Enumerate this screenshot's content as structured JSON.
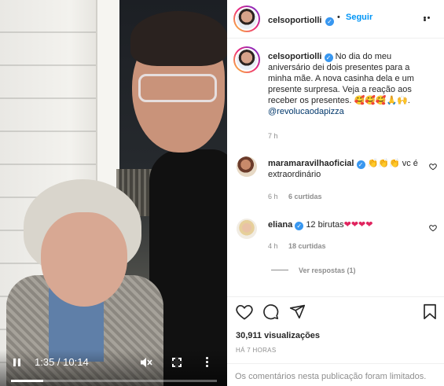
{
  "video": {
    "time": "1:35 / 10:14",
    "progress": 0.155
  },
  "post": {
    "author": "celsoportiolli",
    "follow_label": "Seguir",
    "caption": "No dia do meu aniversário dei dois presentes para a minha mãe. A nova casinha dela e um presente surpresa. Veja a reação aos receber os presentes.",
    "caption_emojis": "🥰🥰🥰🙏🙌.",
    "caption_mention": "@revolucaodapizza",
    "caption_time": "7 h"
  },
  "comments": [
    {
      "username": "maramaravilhaoficial",
      "text_emojis": "👏👏👏",
      "text": "vc é extraordinário",
      "time": "6 h",
      "likes": "6 curtidas"
    },
    {
      "username": "eliana",
      "text": "12 birutas",
      "text_emojis": "❤❤❤❤",
      "time": "4 h",
      "likes": "18 curtidas",
      "replies": "Ver respostas (1)"
    }
  ],
  "stats": {
    "views": "30,911 visualizações",
    "date": "HÁ 7 HORAS"
  },
  "footer": {
    "limited": "Os comentários nesta publicação foram limitados."
  },
  "colors": {
    "link": "#0095f6",
    "verified": "#3897f0",
    "muted": "#8e8e8e",
    "heart": "#ed4956"
  }
}
